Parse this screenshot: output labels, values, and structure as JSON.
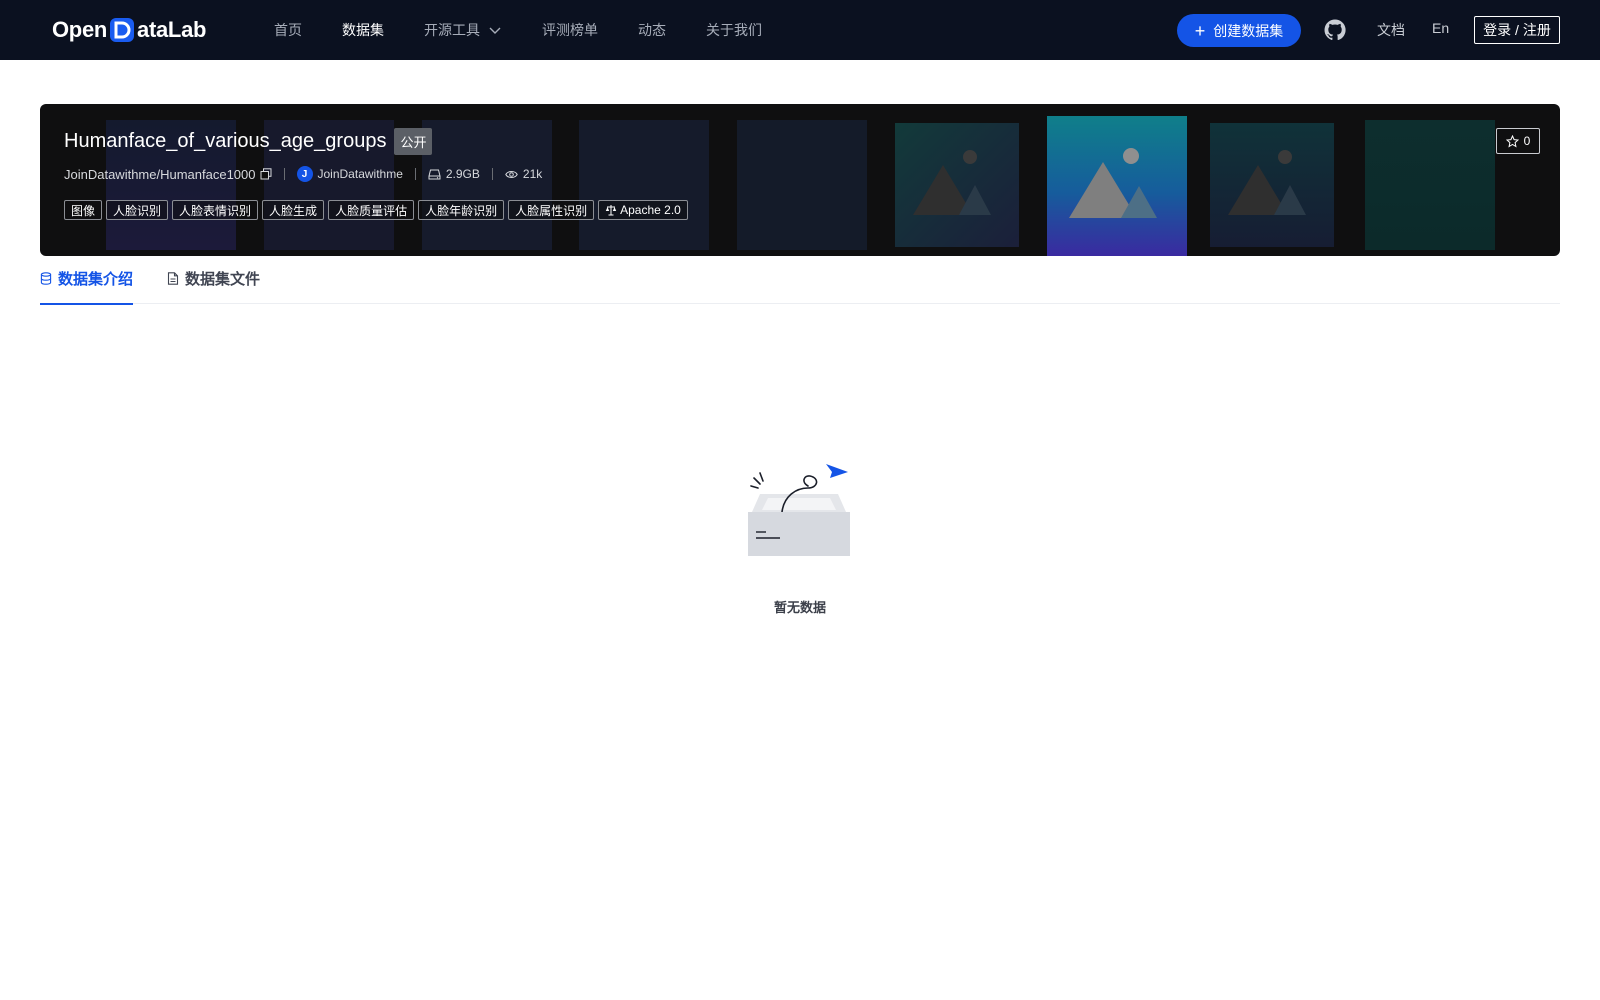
{
  "brand": {
    "logo_text_left": "Open",
    "logo_text_right": "ataLab"
  },
  "nav": {
    "items": [
      {
        "label": "首页",
        "active": false
      },
      {
        "label": "数据集",
        "active": true
      },
      {
        "label": "开源工具",
        "active": false,
        "has_dropdown": true
      },
      {
        "label": "评测榜单",
        "active": false
      },
      {
        "label": "动态",
        "active": false
      },
      {
        "label": "关于我们",
        "active": false
      }
    ],
    "create_button": "创建数据集",
    "github_icon": "github-icon",
    "docs": "文档",
    "lang": "En",
    "login": "登录 / 注册"
  },
  "dataset": {
    "title": "Humanface_of_various_age_groups",
    "visibility": "公开",
    "repo_path": "JoinDatawithme/Humanface1000",
    "owner_initial": "J",
    "owner": "JoinDatawithme",
    "size": "2.9GB",
    "views": "21k",
    "tags": [
      "图像",
      "人脸识别",
      "人脸表情识别",
      "人脸生成",
      "人脸质量评估",
      "人脸年龄识别",
      "人脸属性识别"
    ],
    "license": "Apache 2.0",
    "stars": "0"
  },
  "tabs": [
    {
      "label": "数据集介绍",
      "icon": "database-icon",
      "active": true
    },
    {
      "label": "数据集文件",
      "icon": "file-icon",
      "active": false
    }
  ],
  "empty_state": {
    "text": "暂无数据"
  },
  "colors": {
    "nav_bg": "#0b1120",
    "accent": "#1454e6",
    "banner_bg": "#0f0f10"
  }
}
